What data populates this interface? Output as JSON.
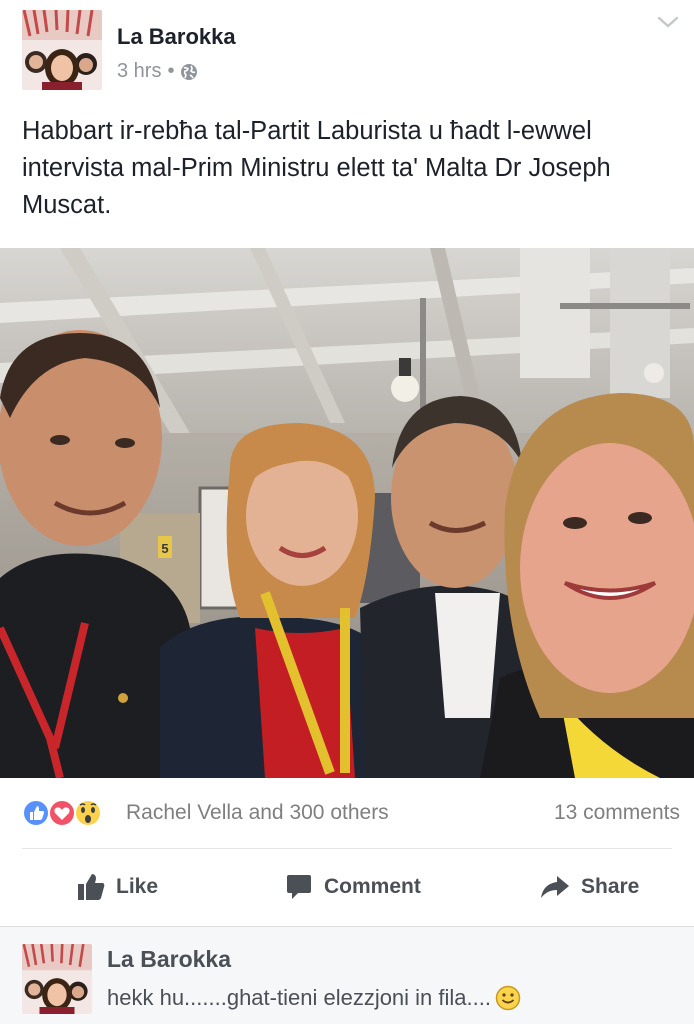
{
  "post": {
    "author": "La Barokka",
    "time": "3 hrs",
    "separator": "•",
    "privacy_icon": "globe-icon",
    "menu_icon": "chevron-down-icon",
    "text": "Habbart ir-rebħa tal-Partit Laburista u ħadt l-ewwel intervista mal-Prim Ministru elett ta' Malta Dr Joseph Muscat."
  },
  "photo": {
    "sign_number": "5"
  },
  "reactions": {
    "icons": [
      "like-reaction-icon",
      "love-reaction-icon",
      "wow-reaction-icon"
    ],
    "summary": "Rachel Vella and 300 others",
    "comments": "13 comments",
    "colors": {
      "like": "#5890ff",
      "love": "#f25268",
      "wow": "#fcd24d"
    }
  },
  "actions": {
    "like": "Like",
    "comment": "Comment",
    "share": "Share"
  },
  "comment_preview": {
    "author": "La Barokka",
    "text": "hekk hu.......ghat-tieni elezzjoni in fila....",
    "emoji": "smiley-icon"
  }
}
